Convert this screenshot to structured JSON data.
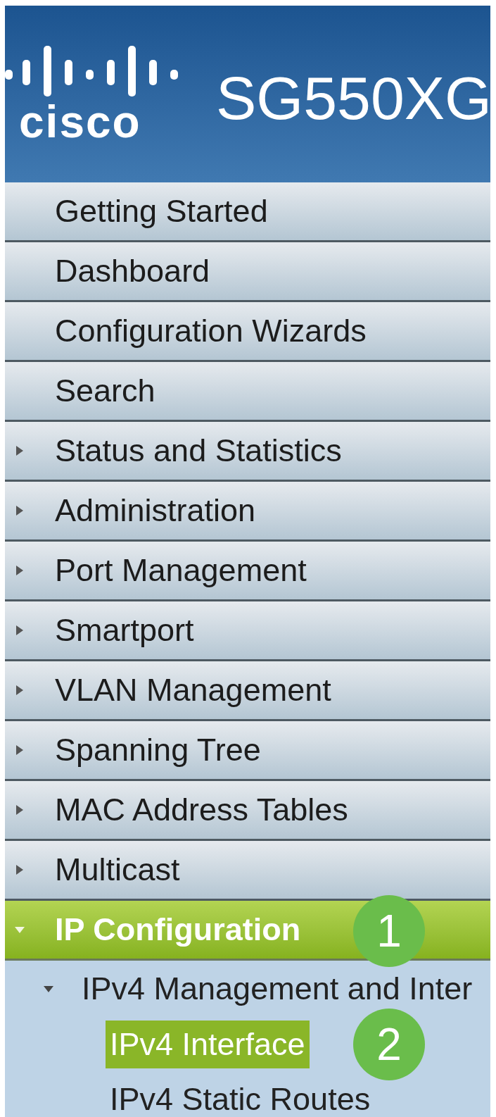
{
  "header": {
    "logo": "cisco",
    "title": "SG550XG"
  },
  "menu": [
    {
      "label": "Getting Started",
      "kind": "link",
      "expanded": false
    },
    {
      "label": "Dashboard",
      "kind": "link",
      "expanded": false
    },
    {
      "label": "Configuration Wizards",
      "kind": "link",
      "expanded": false
    },
    {
      "label": "Search",
      "kind": "link",
      "expanded": false
    },
    {
      "label": "Status and Statistics",
      "kind": "folder",
      "expanded": false
    },
    {
      "label": "Administration",
      "kind": "folder",
      "expanded": false
    },
    {
      "label": "Port Management",
      "kind": "folder",
      "expanded": false
    },
    {
      "label": "Smartport",
      "kind": "folder",
      "expanded": false
    },
    {
      "label": "VLAN Management",
      "kind": "folder",
      "expanded": false
    },
    {
      "label": "Spanning Tree",
      "kind": "folder",
      "expanded": false
    },
    {
      "label": "MAC Address Tables",
      "kind": "folder",
      "expanded": false
    },
    {
      "label": "Multicast",
      "kind": "folder",
      "expanded": false
    },
    {
      "label": "IP Configuration",
      "kind": "folder",
      "expanded": true,
      "badge": "1",
      "children": [
        {
          "label": "IPv4 Management and Inter",
          "expanded": true,
          "children": [
            {
              "label": "IPv4 Interface",
              "selected": true,
              "badge": "2"
            },
            {
              "label": "IPv4 Static Routes",
              "selected": false
            }
          ]
        }
      ]
    }
  ]
}
